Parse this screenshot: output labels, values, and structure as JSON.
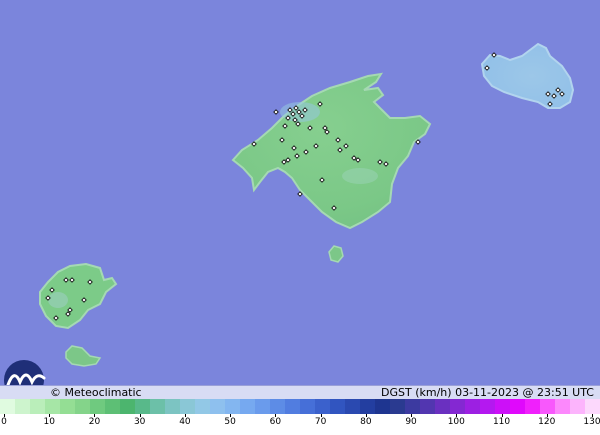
{
  "map": {
    "sea_color": "#7b85dc",
    "land_colors": [
      "#7fcf8a",
      "#9fd6bf",
      "#8ec5ea"
    ],
    "islands": [
      "Mallorca",
      "Menorca",
      "Ibiza",
      "Formentera",
      "Cabrera"
    ],
    "station_marker": "small white diamond"
  },
  "footer": {
    "credit": "© Meteoclimatic",
    "info": "DGST (km/h)  03-11-2023 @ 23:51 UTC",
    "logo_icon": "meteoclimatic-logo-icon"
  },
  "legend": {
    "unit": "km/h",
    "min": 0,
    "max": 130,
    "tick_labels": [
      "0",
      "10",
      "20",
      "30",
      "40",
      "50",
      "60",
      "70",
      "80",
      "90",
      "100",
      "110",
      "120",
      "130"
    ],
    "colors": [
      "#e0fbe0",
      "#cdf4cd",
      "#baeeba",
      "#a6e6a6",
      "#94de94",
      "#84d48a",
      "#6fca7f",
      "#5dbf75",
      "#4cb56e",
      "#58b98a",
      "#6cc0a8",
      "#7cc4c2",
      "#8ac7d6",
      "#92c8e6",
      "#8ec0ee",
      "#83b6f0",
      "#76a9f0",
      "#6a9bec",
      "#5d8ce6",
      "#517de0",
      "#466fd8",
      "#3b61cc",
      "#3155c0",
      "#2a49b0",
      "#233ea0",
      "#1e3590",
      "#2a3a90",
      "#3c3aa0",
      "#5236b0",
      "#6a30c0",
      "#8428d2",
      "#9c20e2",
      "#b418f0",
      "#cc10f8",
      "#e008fc",
      "#f020fc",
      "#f858fc",
      "#fc88fc",
      "#fcb4fc",
      "#fcd8fc"
    ]
  }
}
